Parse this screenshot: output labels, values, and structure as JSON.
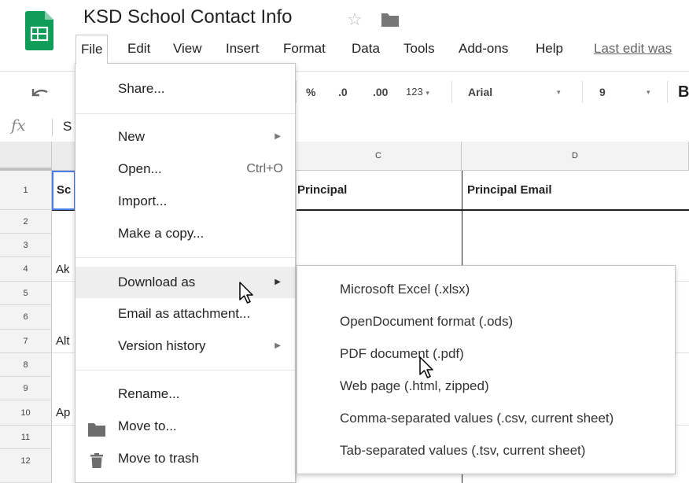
{
  "header": {
    "doc_title": "KSD School Contact Info",
    "last_edit": "Last edit was",
    "icons": [
      "google-sheets-logo",
      "star-icon",
      "folder-icon"
    ]
  },
  "menubar": [
    "File",
    "Edit",
    "View",
    "Insert",
    "Format",
    "Data",
    "Tools",
    "Add-ons",
    "Help"
  ],
  "toolbar": {
    "percent": "%",
    "dec_decrease": ".0",
    "dec_increase": ".00",
    "more_formats": "123",
    "font": "Arial",
    "font_size": "9",
    "bold": "B"
  },
  "formula_bar": {
    "fx": "fx",
    "content": "S"
  },
  "grid": {
    "col_headers": [
      "C",
      "D"
    ],
    "row_numbers": [
      "1",
      "2",
      "3",
      "4",
      "5",
      "6",
      "7",
      "8",
      "9",
      "10",
      "11",
      "12"
    ],
    "cells": {
      "A1": "Sc",
      "A4": "Ak",
      "A7": "Alt",
      "A10": "Ap",
      "C1": "Principal",
      "D1": "Principal Email"
    }
  },
  "file_menu": {
    "share": "Share...",
    "new": "New",
    "open": "Open...",
    "open_shortcut": "Ctrl+O",
    "import": "Import...",
    "make_copy": "Make a copy...",
    "download_as": "Download as",
    "email_attachment": "Email as attachment...",
    "version_history": "Version history",
    "rename": "Rename...",
    "move_to": "Move to...",
    "move_to_trash": "Move to trash"
  },
  "download_submenu": [
    "Microsoft Excel (.xlsx)",
    "OpenDocument format (.ods)",
    "PDF document (.pdf)",
    "Web page (.html, zipped)",
    "Comma-separated values (.csv, current sheet)",
    "Tab-separated values (.tsv, current sheet)"
  ],
  "colors": {
    "sheets_green": "#0f9d58",
    "menu_highlight": "#eeeeee",
    "header_bg": "#f3f3f3"
  }
}
